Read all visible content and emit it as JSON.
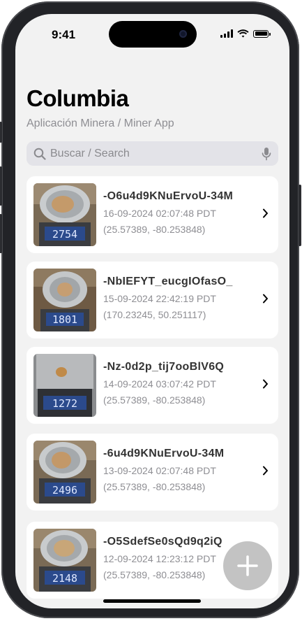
{
  "status_bar": {
    "time": "9:41"
  },
  "header": {
    "title": "Columbia",
    "subtitle": "Aplicación Minera / Miner App"
  },
  "search": {
    "placeholder": "Buscar / Search",
    "value": ""
  },
  "records": [
    {
      "id": "-O6u4d9KNuErvoU-34M",
      "date": "16-09-2024 02:07:48 PDT",
      "coords": "(25.57389, -80.253848)",
      "scale_reading": "2754"
    },
    {
      "id": "-NbIEFYT_eucgIOfasO_",
      "date": "15-09-2024 22:42:19 PDT",
      "coords": "(170.23245, 50.251117)",
      "scale_reading": "1801"
    },
    {
      "id": "-Nz-0d2p_tij7ooBlV6Q",
      "date": "14-09-2024 03:07:42 PDT",
      "coords": "(25.57389, -80.253848)",
      "scale_reading": "1272"
    },
    {
      "id": "-6u4d9KNuErvoU-34M",
      "date": "13-09-2024 02:07:48 PDT",
      "coords": "(25.57389, -80.253848)",
      "scale_reading": "2496"
    },
    {
      "id": "-O5SdefSe0sQd9q2iQ",
      "date": "12-09-2024 12:23:12 PDT",
      "coords": "(25.57389, -80.253848)",
      "scale_reading": "2148"
    }
  ],
  "icons": {
    "search": "search-icon",
    "mic": "mic-icon",
    "chevron": "chevron-right-icon",
    "add": "plus-icon"
  },
  "colors": {
    "background": "#f2f2f2",
    "card": "#ffffff",
    "secondary_text": "#8e8e93",
    "fab": "#bebebe"
  }
}
